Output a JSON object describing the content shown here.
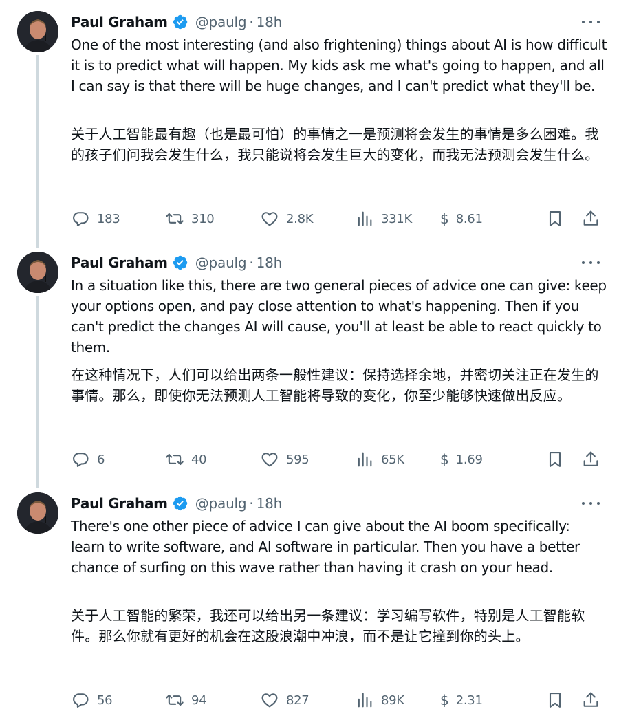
{
  "tweets": [
    {
      "author": {
        "name": "Paul Graham",
        "handle": "@paulg",
        "time": "18h"
      },
      "text_en": "One of the most interesting (and also frightening) things about AI is how difficult it is to predict what will happen. My kids ask me what's going to happen, and all I can say is that there will be huge changes, and I can't predict what they'll be.",
      "text_zh": "关于人工智能最有趣（也是最可怕）的事情之一是预测将会发生的事情是多么困难。我的孩子们问我会发生什么，我只能说将会发生巨大的变化，而我无法预测会发生什么。",
      "stats": {
        "replies": "183",
        "retweets": "310",
        "likes": "2.8K",
        "views": "331K",
        "tip": "8.61"
      }
    },
    {
      "author": {
        "name": "Paul Graham",
        "handle": "@paulg",
        "time": "18h"
      },
      "text_en": "In a situation like this, there are two general pieces of advice one can give: keep your options open, and pay close attention to what's happening. Then if you can't predict the changes AI will cause, you'll at least be able to react quickly to them.",
      "text_zh": "在这种情况下，人们可以给出两条一般性建议：保持选择余地，并密切关注正在发生的事情。那么，即使你无法预测人工智能将导致的变化，你至少能够快速做出反应。",
      "stats": {
        "replies": "6",
        "retweets": "40",
        "likes": "595",
        "views": "65K",
        "tip": "1.69"
      }
    },
    {
      "author": {
        "name": "Paul Graham",
        "handle": "@paulg",
        "time": "18h"
      },
      "text_en": "There's one other piece of advice I can give about the AI boom specifically: learn to write software, and AI software in particular. Then you have a better chance of surfing on this wave rather than having it crash on your head.",
      "text_zh": "关于人工智能的繁荣，我还可以给出另一条建议：学习编写软件，特别是人工智能软件。那么你就有更好的机会在这股浪潮中冲浪，而不是让它撞到你的头上。",
      "stats": {
        "replies": "56",
        "retweets": "94",
        "likes": "827",
        "views": "89K",
        "tip": "2.31"
      }
    }
  ],
  "tip_symbol": "$",
  "separator": "·",
  "icons": {
    "reply": "reply-icon",
    "retweet": "retweet-icon",
    "like": "heart-icon",
    "views": "views-icon",
    "bookmark": "bookmark-icon",
    "share": "share-icon",
    "verified": "verified-badge-icon",
    "more": "more-icon"
  },
  "colors": {
    "text": "#0f1419",
    "secondary": "#536471",
    "verified": "#1d9bf0",
    "thread_line": "#cfd9de"
  }
}
